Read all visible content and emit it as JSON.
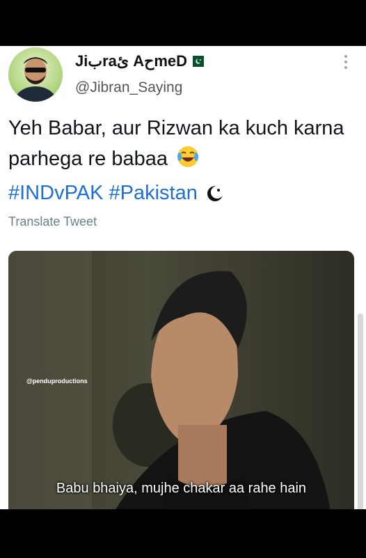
{
  "tweet": {
    "author_name": "Jiبraئ AحmeD",
    "handle": "@Jibran_Saying",
    "text_plain": "Yeh Babar, aur Rizwan ka kuch karna parhega re babaa",
    "hashtags": "#INDvPAK #Pakistan",
    "translate_label": "Translate Tweet",
    "media": {
      "watermark": "@penduproductions",
      "subtitle": "Babu bhaiya, mujhe chakar aa rahe hain"
    }
  },
  "icons": {
    "more": "more-dots-icon",
    "verified_flag": "flag-icon",
    "emoji": "laughing-emoji-icon",
    "crescent": "crescent-icon"
  }
}
